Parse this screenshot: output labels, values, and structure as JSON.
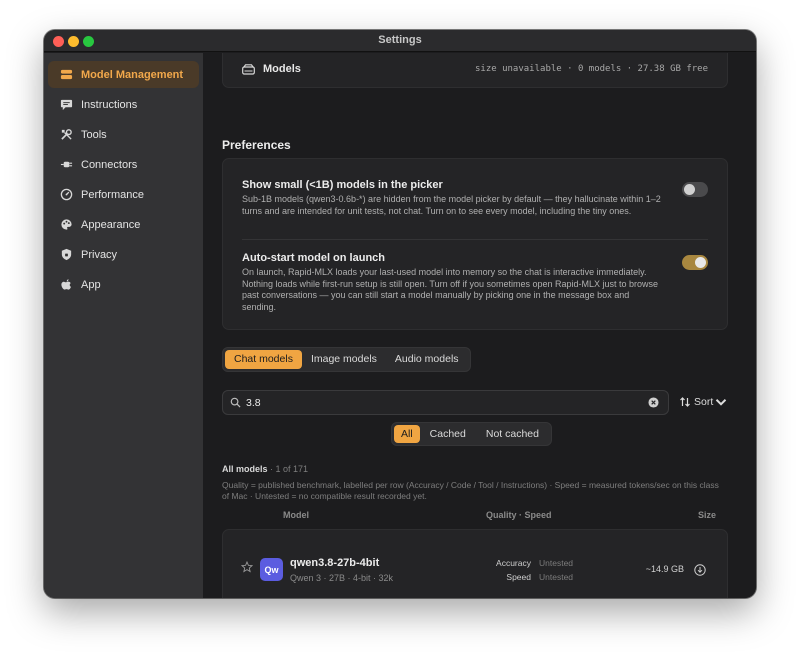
{
  "window": {
    "title": "Settings"
  },
  "sidebar": {
    "items": [
      {
        "label": "Model Management",
        "icon": "stack-icon",
        "active": true
      },
      {
        "label": "Instructions",
        "icon": "chat-bubble-icon"
      },
      {
        "label": "Tools",
        "icon": "wrench-screwdriver-icon"
      },
      {
        "label": "Connectors",
        "icon": "plug-icon"
      },
      {
        "label": "Performance",
        "icon": "gauge-icon"
      },
      {
        "label": "Appearance",
        "icon": "palette-icon"
      },
      {
        "label": "Privacy",
        "icon": "shield-icon"
      },
      {
        "label": "App",
        "icon": "apple-icon"
      }
    ]
  },
  "models_summary": {
    "label": "Models",
    "meta": "size unavailable · 0 models · 27.38 GB free"
  },
  "preferences": {
    "title": "Preferences",
    "items": [
      {
        "title": "Show small (<1B) models in the picker",
        "description": "Sub-1B models (qwen3-0.6b-*) are hidden from the model picker by default — they hallucinate within 1–2 turns and are intended for unit tests, not chat. Turn on to see every model, including the tiny ones.",
        "enabled": false
      },
      {
        "title": "Auto-start model on launch",
        "description": "On launch, Rapid-MLX loads your last-used model into memory so the chat is interactive immediately. Nothing loads while first-run setup is still open. Turn off if you sometimes open Rapid-MLX just to browse past conversations — you can still start a model manually by picking one in the message box and sending.",
        "enabled": true
      }
    ]
  },
  "tabs": {
    "items": [
      "Chat models",
      "Image models",
      "Audio models"
    ],
    "active": 0
  },
  "search": {
    "value": "3.8",
    "placeholder": ""
  },
  "sort": {
    "label": "Sort"
  },
  "filters": {
    "items": [
      "All",
      "Cached",
      "Not cached"
    ],
    "active": 0
  },
  "list": {
    "title": "All models",
    "count": "1 of 171",
    "legend": "Quality = published benchmark, labelled per row (Accuracy / Code / Tool / Instructions) · Speed = measured tokens/sec on this class of Mac · Untested = no compatible result recorded yet.",
    "columns": {
      "model": "Model",
      "quality_speed": "Quality · Speed",
      "size": "Size"
    }
  },
  "models": [
    {
      "badge": "Qw",
      "name": "qwen3.8-27b-4bit",
      "subtitle": "Qwen 3 · 27B · 4-bit · 32k",
      "accuracy_label": "Accuracy",
      "accuracy_value": "Untested",
      "speed_label": "Speed",
      "speed_value": "Untested",
      "size": "~14.9 GB"
    }
  ],
  "colors": {
    "accent": "#f0a542",
    "badge": "#5b5ce0",
    "toggle_on": "#a8873f"
  }
}
